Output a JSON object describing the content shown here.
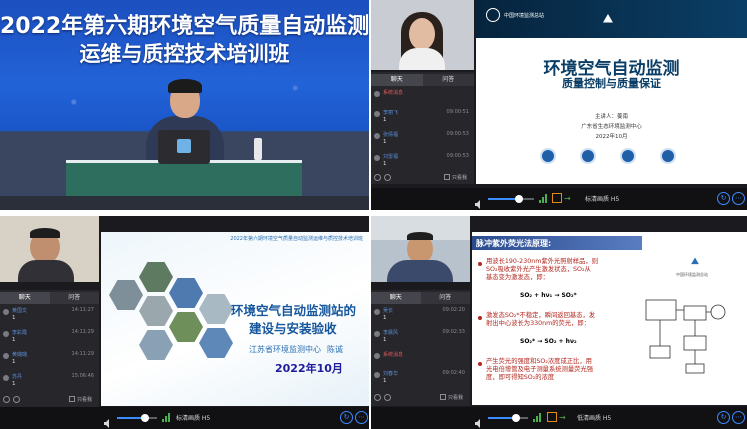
{
  "panel1": {
    "title_line1": "2022年第六期环境空气质量自动监测",
    "title_line2": "运维与质控技术培训班"
  },
  "panel2": {
    "tabs": [
      "聊天",
      "问答"
    ],
    "messages": [
      {
        "name": "系统消息",
        "time": "",
        "body": "",
        "system": true
      },
      {
        "name": "李丽飞",
        "time": "09:00:51",
        "body": "1"
      },
      {
        "name": "张倩福",
        "time": "09:00:53",
        "body": "1"
      },
      {
        "name": "刘雷福",
        "time": "09:00:53",
        "body": "1"
      }
    ],
    "mute_label": "只看我",
    "resolution": "标清画质 H5",
    "slide": {
      "org": "中国环境监测总站",
      "title": "环境空气自动监测",
      "subtitle": "质量控制与质量保证",
      "speaker": "主讲人：姜南",
      "unit": "广东省生态环境监测中心",
      "date": "2022年10月"
    }
  },
  "panel3": {
    "tabs": [
      "聊天",
      "问答"
    ],
    "messages": [
      {
        "name": "黄国文",
        "time": "14:11:27",
        "body": "1"
      },
      {
        "name": "李彩霞",
        "time": "14:11:29",
        "body": "1"
      },
      {
        "name": "黄璐璐",
        "time": "14:11:29",
        "body": "1"
      },
      {
        "name": "苏丹",
        "time": "15:06:46",
        "body": "1"
      }
    ],
    "mute_label": "只看我",
    "resolution": "标清画质 H5",
    "slide": {
      "header": "2022年第六期环境空气质量自动监测运维与质控技术培训班",
      "title_line1": "环境空气自动监测站的",
      "title_line2": "建设与安装验收",
      "org": "江苏省环境监测中心",
      "speaker": "陈诚",
      "date": "2022年10月"
    }
  },
  "panel4": {
    "tabs": [
      "聊天",
      "问答"
    ],
    "messages": [
      {
        "name": "吴长",
        "time": "09:02:20",
        "body": "1"
      },
      {
        "name": "李晨风",
        "time": "09:02:33",
        "body": "1"
      },
      {
        "name": "系统消息",
        "time": "",
        "body": "",
        "system": true
      },
      {
        "name": "刘春华",
        "time": "09:02:40",
        "body": "1"
      }
    ],
    "mute_label": "只看我",
    "resolution": "低清画质 H5",
    "slide": {
      "title": "脉冲紫外荧光法原理:",
      "logo_text": "中国环境监测总站",
      "para1_line1": "用波长190-230nm紫外光照射样品，则",
      "para1_line2": "SO₂吸收紫外光产生激发状态，SO₂从",
      "para1_line3": "基态变为激发态，即：",
      "eq1": "SO₂ + hν₁ → SO₂*",
      "para2_line1": "激发态SO₂*不稳定，瞬间返回基态，发",
      "para2_line2": "射出中心波长为330nm的荧光，即：",
      "eq2": "SO₂* → SO₂ + hν₂",
      "para3_line1": "产生荧光的强度和SO₂浓度成正比，用",
      "para3_line2": "光电倍增管及电子测量系统测量荧光强",
      "para3_line3": "度，即可得知SO₂的浓度"
    }
  },
  "colors": {
    "accent": "#3b8cff",
    "stage_blue": "#1f5ccf",
    "chat_name": "#5b8fd6",
    "system_red": "#e05c5c",
    "slide_title_blue": "#15569c"
  }
}
